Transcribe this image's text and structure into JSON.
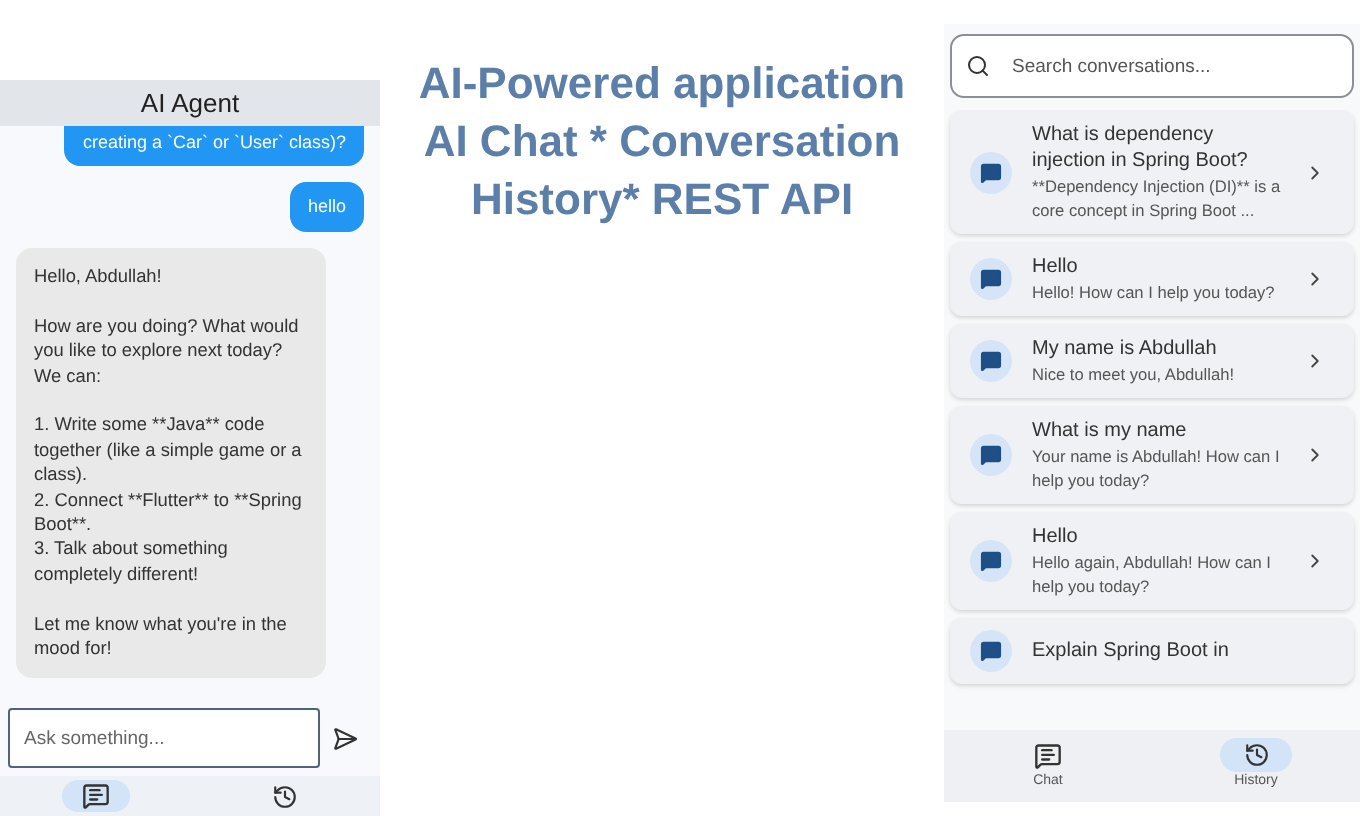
{
  "chat": {
    "title": "AI Agent",
    "messages": [
      {
        "kind": "user",
        "text": "creating a `Car` or `User` class)?"
      },
      {
        "kind": "user",
        "text": "hello"
      },
      {
        "kind": "assistant",
        "text": "Hello, Abdullah!\n\nHow are you doing? What would you like to explore next today? We can:\n\n1. Write some **Java** code together (like a simple game or a class).\n2. Connect **Flutter** to **Spring Boot**.\n3. Talk about something completely different!\n\nLet me know what you're in the mood for!"
      }
    ],
    "input": {
      "placeholder": "Ask something..."
    },
    "nav": [
      {
        "kind": "chat",
        "selected": true
      },
      {
        "kind": "history",
        "selected": false
      }
    ]
  },
  "headline": [
    "AI-Powered application",
    "AI Chat * Conversation",
    "History* REST API"
  ],
  "history": {
    "search": {
      "placeholder": "Search conversations..."
    },
    "conversations": [
      {
        "title": "What is dependency injection in Spring Boot?",
        "preview": "**Dependency Injection (DI)** is a core concept in Spring Boot ..."
      },
      {
        "title": "Hello",
        "preview": "Hello! How can I help you today?"
      },
      {
        "title": "My name is Abdullah",
        "preview": "Nice to meet you, Abdullah!"
      },
      {
        "title": "What is my name",
        "preview": "Your name is Abdullah! How can I help you today?"
      },
      {
        "title": "Hello",
        "preview": "Hello again, Abdullah! How can I help you today?"
      },
      {
        "title": "Explain Spring Boot in"
      }
    ],
    "nav": [
      {
        "kind": "chat",
        "label": "Chat",
        "selected": false
      },
      {
        "kind": "history",
        "label": "History",
        "selected": true
      }
    ]
  }
}
